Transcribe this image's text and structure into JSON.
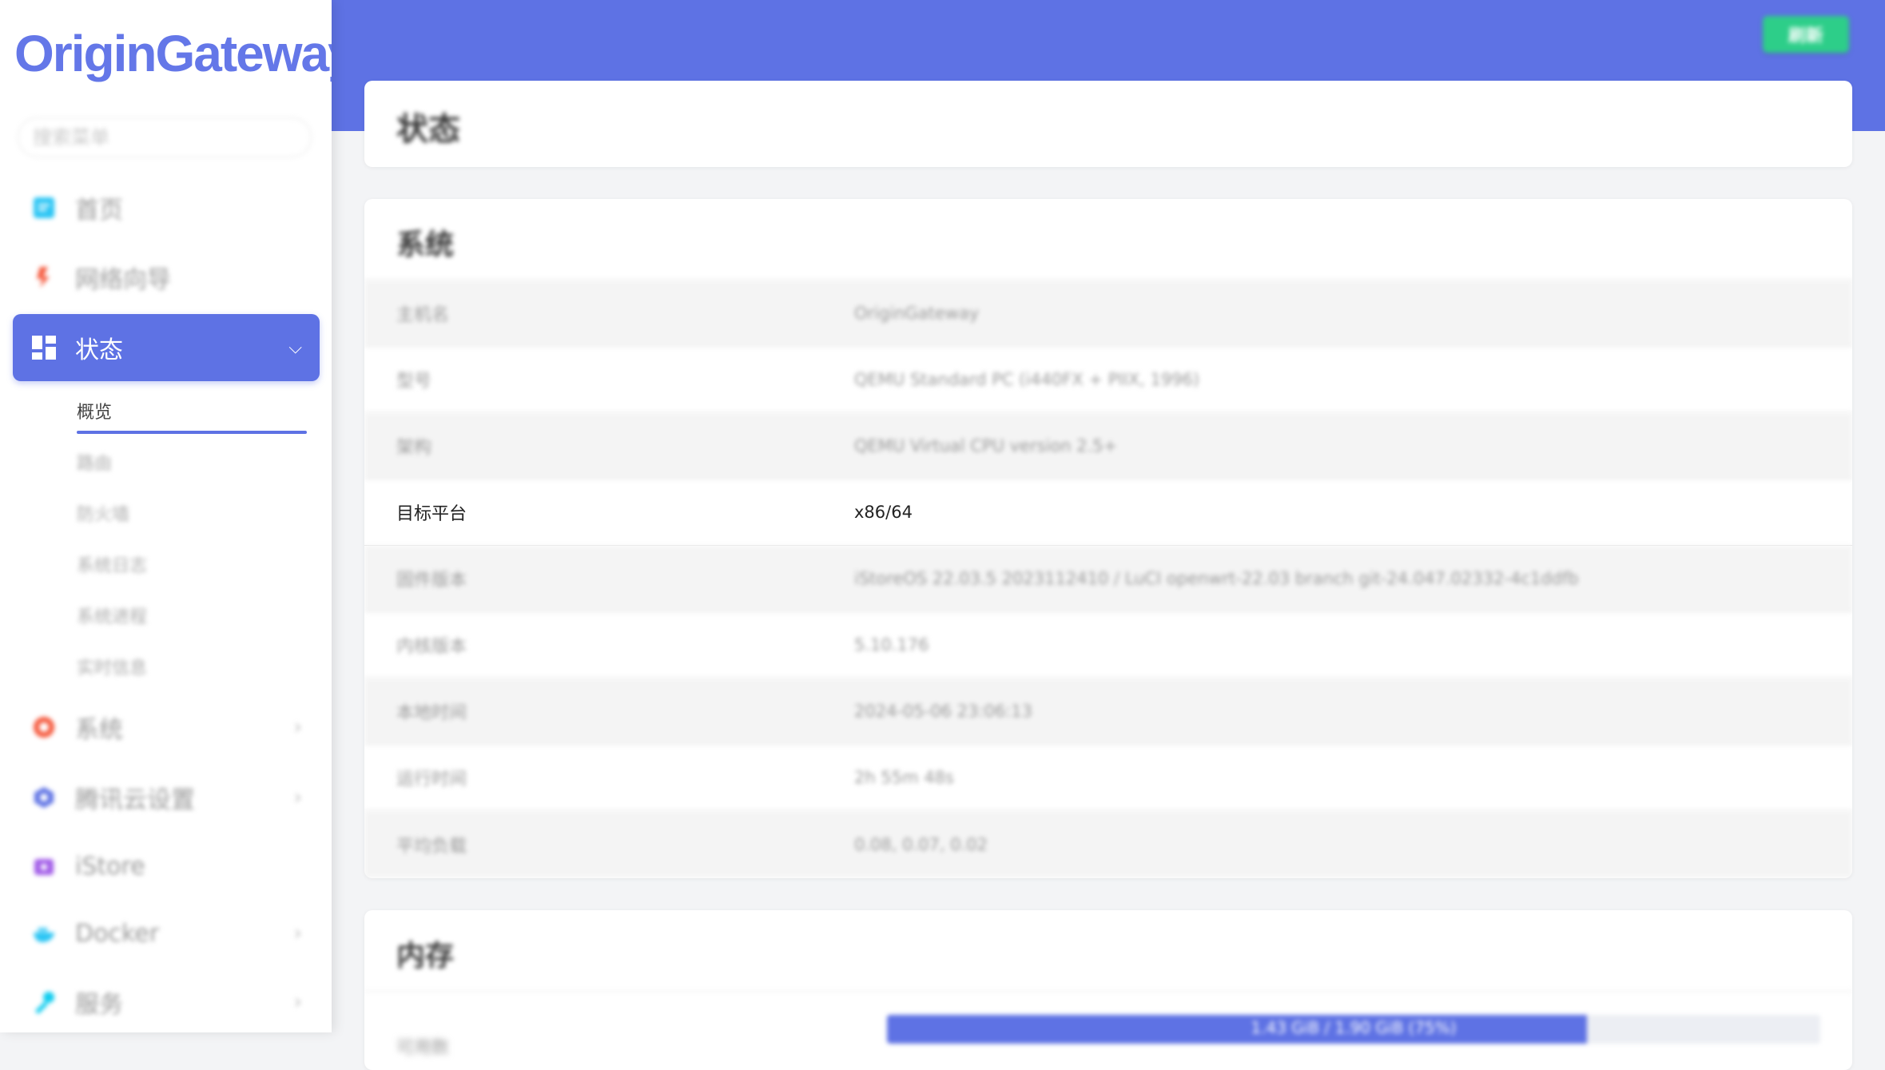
{
  "sidebar": {
    "logo": "OriginGateway",
    "search_placeholder": "搜索菜单",
    "items": [
      {
        "label": "首页",
        "icon": "home-icon",
        "color": "#2bc5f4"
      },
      {
        "label": "网络向导",
        "icon": "wizard-icon",
        "color": "#f5593d"
      },
      {
        "label": "状态",
        "icon": "dashboard-icon",
        "color": "#ffffff",
        "active": true
      },
      {
        "label": "系统",
        "icon": "system-icon",
        "color": "#f5593d"
      },
      {
        "label": "腾讯云设置",
        "icon": "cloud-icon",
        "color": "#5e72e4"
      },
      {
        "label": "iStore",
        "icon": "store-icon",
        "color": "#a25de8"
      },
      {
        "label": "Docker",
        "icon": "docker-icon",
        "color": "#2bc5f4"
      },
      {
        "label": "服务",
        "icon": "service-icon",
        "color": "#11cdef"
      }
    ],
    "status_sub": [
      "概览",
      "路由",
      "防火墙",
      "系统日志",
      "系统进程",
      "实时信息"
    ]
  },
  "header": {
    "refresh_label": "刷新",
    "accent": "#5e72e4",
    "refresh_color": "#2dce89"
  },
  "page": {
    "title": "状态"
  },
  "system": {
    "title": "系统",
    "rows": [
      {
        "key": "主机名",
        "value": "OriginGateway"
      },
      {
        "key": "型号",
        "value": "QEMU Standard PC (i440FX + PIIX, 1996)"
      },
      {
        "key": "架构",
        "value": "QEMU Virtual CPU version 2.5+"
      },
      {
        "key": "目标平台",
        "value": "x86/64"
      },
      {
        "key": "固件版本",
        "value": "iStoreOS 22.03.5 2023112410 / LuCI openwrt-22.03 branch git-24.047.02332-4c1ddfb"
      },
      {
        "key": "内核版本",
        "value": "5.10.176"
      },
      {
        "key": "本地时间",
        "value": "2024-05-06 23:06:13"
      },
      {
        "key": "运行时间",
        "value": "2h 55m 48s"
      },
      {
        "key": "平均负载",
        "value": "0.08, 0.07, 0.02"
      }
    ]
  },
  "memory": {
    "title": "内存",
    "rows": [
      {
        "key": "可用数",
        "progress_text": "1.43 GiB / 1.90 GiB (75%)",
        "percent": 75
      }
    ]
  }
}
